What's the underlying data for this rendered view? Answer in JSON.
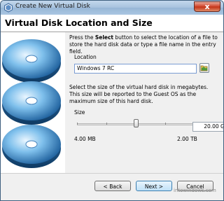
{
  "window": {
    "title": "Create New Virtual Disk",
    "close_glyph": "x"
  },
  "header": {
    "title": "Virtual Disk Location and Size"
  },
  "location": {
    "instructions_before": "Press the ",
    "instructions_bold": "Select",
    "instructions_after": " button to select the location of a file to store the hard disk data or type a file name in the entry field.",
    "label": "Location",
    "value": "Windows 7 RC"
  },
  "size": {
    "instructions": "Select the size of the virtual hard disk in megabytes. This size will be reported to the Guest OS as the maximum size of this hard disk.",
    "label": "Size",
    "value": "20.00 GB",
    "min_label": "4.00 MB",
    "max_label": "2.00 TB",
    "slider_fraction": 0.5
  },
  "buttons": {
    "back": "< Back",
    "next": "Next >",
    "cancel": "Cancel"
  },
  "watermark": "intowindows.com",
  "icons": [
    "virtualbox-icon",
    "close-icon",
    "disk-stack-icon",
    "folder-browse-icon"
  ]
}
